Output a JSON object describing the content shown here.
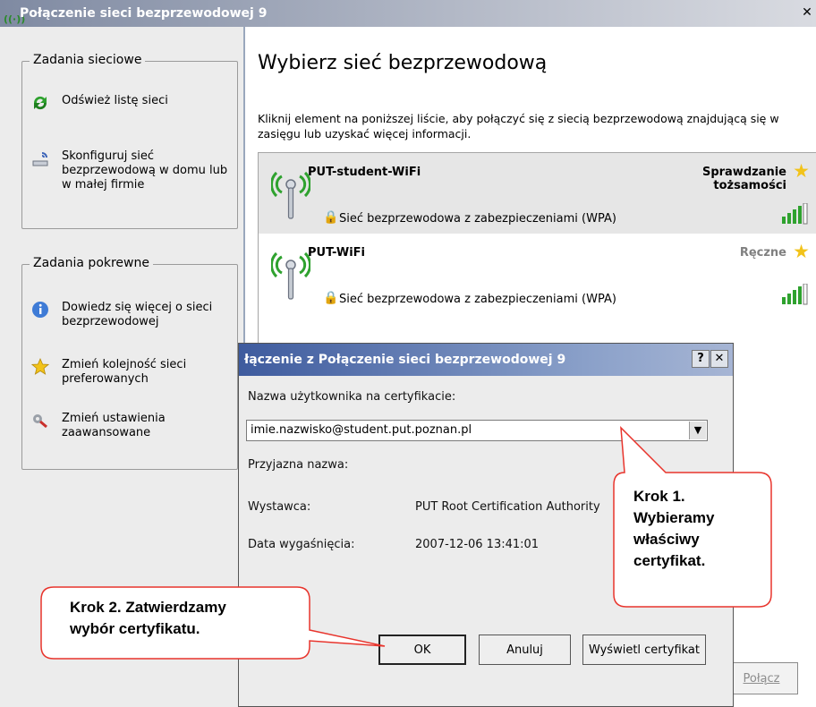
{
  "window": {
    "title": "Połączenie sieci bezprzewodowej 9",
    "close_glyph": "✕"
  },
  "left_pane": {
    "network_tasks": {
      "title": "Zadania sieciowe",
      "items": [
        {
          "label": "Odśwież listę sieci",
          "icon": "refresh-icon"
        },
        {
          "label": "Skonfiguruj sieć bezprzewodową w domu lub w małej firmie",
          "icon": "wireless-setup-icon"
        }
      ]
    },
    "related_tasks": {
      "title": "Zadania pokrewne",
      "items": [
        {
          "label": "Dowiedz się więcej o sieci bezprzewodowej",
          "icon": "info-icon"
        },
        {
          "label": "Zmień kolejność sieci preferowanych",
          "icon": "star-icon"
        },
        {
          "label": "Zmień ustawienia zaawansowane",
          "icon": "settings-icon"
        }
      ]
    }
  },
  "main": {
    "heading": "Wybierz sieć bezprzewodową",
    "instruction": "Kliknij element na poniższej liście, aby połączyć się z siecią bezprzewodową znajdującą się w zasięgu lub uzyskać więcej informacji.",
    "networks": [
      {
        "name": "PUT-student-WiFi",
        "status_line1": "Sprawdzanie",
        "status_line2": "tożsamości",
        "security": "Sieć bezprzewodowa z zabezpieczeniami (WPA)",
        "selected": true
      },
      {
        "name": "PUT-WiFi",
        "status_line1": "Ręczne",
        "status_line2": "",
        "security": "Sieć bezprzewodowa z zabezpieczeniami (WPA)",
        "selected": false
      }
    ],
    "connect_label": "Połącz"
  },
  "dialog": {
    "title": "łączenie z Połączenie sieci bezprzewodowej 9",
    "help_glyph": "?",
    "close_glyph": "✕",
    "user_label": "Nazwa użytkownika na certyfikacie:",
    "user_value": "imie.nazwisko@student.put.poznan.pl",
    "friendly_label": "Przyjazna nazwa:",
    "issuer_label": "Wystawca:",
    "issuer_value": "PUT Root Certification Authority",
    "expiry_label": "Data wygaśnięcia:",
    "expiry_value": "2007-12-06 13:41:01",
    "ok_label": "OK",
    "cancel_label": "Anuluj",
    "view_cert_label": "Wyświetl certyfikat"
  },
  "callouts": {
    "step1": [
      "Krok 1.",
      "Wybieramy",
      "właściwy",
      "certyfikat."
    ],
    "step2": [
      "Krok 2. Zatwierdzamy",
      "wybór certyfikatu."
    ]
  },
  "colors": {
    "callout_border": "#e8342c",
    "selected_row": "#e6e6e6",
    "dialog_title": "#3e5b9e"
  }
}
